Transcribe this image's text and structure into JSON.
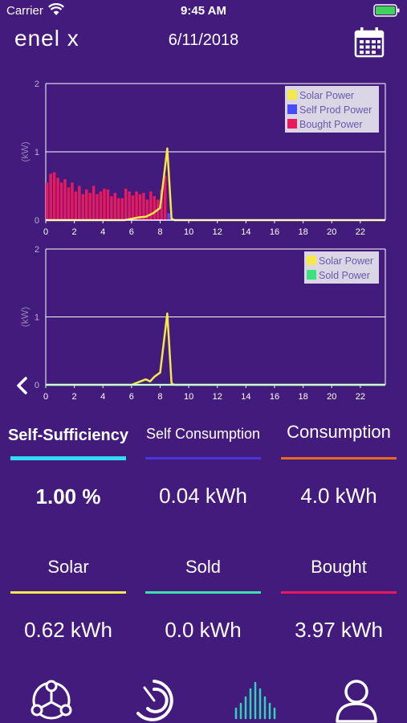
{
  "status_bar": {
    "carrier": "Carrier",
    "time": "9:45 AM"
  },
  "header": {
    "logo": "enel x",
    "date": "6/11/2018"
  },
  "colors": {
    "background": "#431b7c",
    "solar": "#f5e84a",
    "self_prod": "#4a4aff",
    "bought": "#e8195e",
    "sold": "#3fe07f",
    "self_sufficiency": "#33ddf5",
    "self_consumption": "#4b36d8",
    "consumption": "#e86a1e"
  },
  "stats_row1": [
    {
      "title": "Self-Sufficiency",
      "value": "1.00 %"
    },
    {
      "title": "Self Consumption",
      "value": "0.04 kWh"
    },
    {
      "title": "Consumption",
      "value": "4.0 kWh"
    }
  ],
  "stats_row2": [
    {
      "title": "Solar",
      "value": "0.62 kWh"
    },
    {
      "title": "Sold",
      "value": "0.0 kWh"
    },
    {
      "title": "Bought",
      "value": "3.97 kWh"
    }
  ],
  "icons": {
    "tab1": "network-icon",
    "tab2": "gauge-icon",
    "tab3": "bar-chart-icon",
    "tab4": "user-icon",
    "back": "chevron-left-icon",
    "calendar": "calendar-icon"
  },
  "chart_data": [
    {
      "type": "bar",
      "ylabel": "(kW)",
      "ylim": [
        0,
        2
      ],
      "ytick_labels": [
        "0",
        "1",
        "2"
      ],
      "xtick_labels": [
        "0",
        "2",
        "4",
        "6",
        "8",
        "10",
        "12",
        "14",
        "16",
        "18",
        "20",
        "22"
      ],
      "legend": [
        "Solar Power",
        "Self Prod Power",
        "Bought Power"
      ],
      "legend_position": "top-right",
      "bar_x": [
        0,
        0.25,
        0.5,
        0.75,
        1,
        1.25,
        1.5,
        1.75,
        2,
        2.25,
        2.5,
        2.75,
        3,
        3.25,
        3.5,
        3.75,
        4,
        4.25,
        4.5,
        4.75,
        5,
        5.25,
        5.5,
        5.75,
        6,
        6.25,
        6.5,
        6.75,
        7,
        7.25,
        7.5,
        7.75,
        8,
        8.25,
        8.5
      ],
      "series": [
        {
          "name": "Bought Power",
          "values": [
            0.55,
            0.68,
            0.7,
            0.62,
            0.55,
            0.6,
            0.48,
            0.55,
            0.42,
            0.5,
            0.38,
            0.45,
            0.4,
            0.5,
            0.38,
            0.42,
            0.46,
            0.45,
            0.35,
            0.4,
            0.32,
            0.32,
            0.46,
            0.42,
            0.36,
            0.42,
            0.38,
            0.4,
            0.3,
            0.42,
            0.35,
            0.3,
            0.45,
            0.65,
            0.1
          ]
        },
        {
          "name": "Self Prod Power",
          "values": [
            0,
            0,
            0,
            0,
            0,
            0,
            0,
            0,
            0,
            0,
            0,
            0,
            0,
            0,
            0,
            0,
            0,
            0,
            0,
            0,
            0,
            0,
            0,
            0,
            0,
            0,
            0,
            0,
            0,
            0,
            0,
            0,
            0,
            0,
            0.1
          ]
        },
        {
          "name": "Solar Power",
          "x": [
            0,
            5.5,
            6,
            6.5,
            7,
            7.5,
            8,
            8.5,
            8.8,
            9,
            23.75
          ],
          "values": [
            0,
            0,
            0.02,
            0.04,
            0.05,
            0.1,
            0.18,
            1.05,
            0.02,
            0,
            0
          ]
        }
      ]
    },
    {
      "type": "line",
      "ylabel": "(kW)",
      "ylim": [
        0,
        2
      ],
      "ytick_labels": [
        "0",
        "1",
        "2"
      ],
      "xtick_labels": [
        "0",
        "2",
        "4",
        "6",
        "8",
        "10",
        "12",
        "14",
        "16",
        "18",
        "20",
        "22"
      ],
      "legend": [
        "Solar Power",
        "Sold Power"
      ],
      "legend_position": "top-right",
      "series": [
        {
          "name": "Solar Power",
          "x": [
            0,
            6,
            6.5,
            7,
            7.3,
            7.6,
            8,
            8.5,
            8.8,
            9,
            23.75
          ],
          "values": [
            0,
            0,
            0.04,
            0.08,
            0.05,
            0.12,
            0.18,
            1.05,
            0.02,
            0,
            0
          ]
        },
        {
          "name": "Sold Power",
          "x": [
            0,
            23.75
          ],
          "values": [
            0,
            0
          ]
        }
      ]
    }
  ]
}
